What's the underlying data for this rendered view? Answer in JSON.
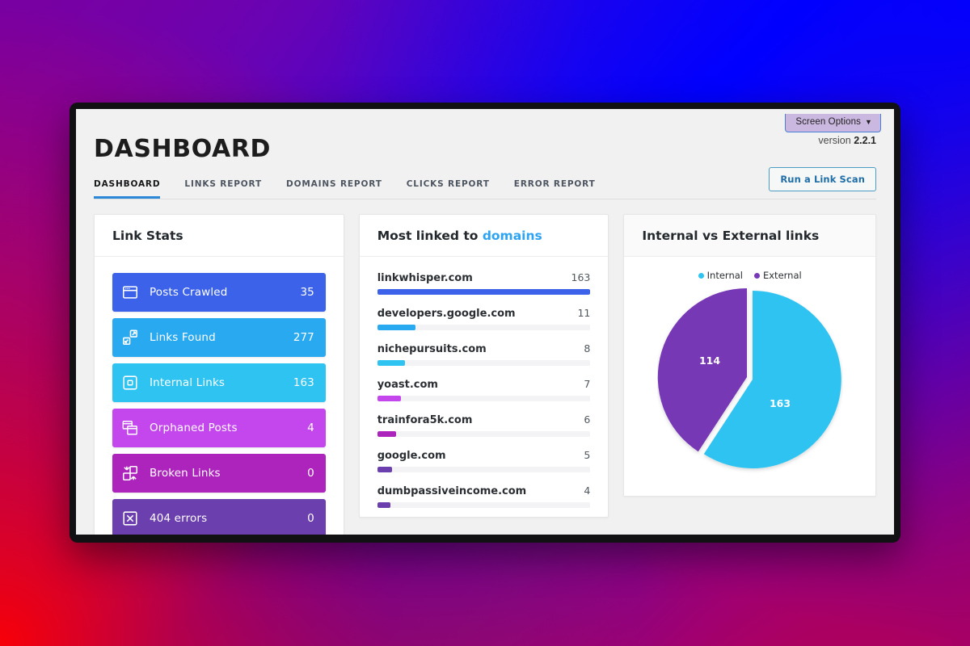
{
  "header": {
    "title": "DASHBOARD",
    "screen_options_label": "Screen Options",
    "screen_options_caret": "▼",
    "version_prefix": "version",
    "version_number": "2.2.1",
    "scan_button": "Run a Link Scan"
  },
  "tabs": [
    {
      "label": "DASHBOARD",
      "active": true
    },
    {
      "label": "LINKS REPORT",
      "active": false
    },
    {
      "label": "DOMAINS REPORT",
      "active": false
    },
    {
      "label": "CLICKS REPORT",
      "active": false
    },
    {
      "label": "ERROR REPORT",
      "active": false
    }
  ],
  "link_stats": {
    "title": "Link Stats",
    "rows": [
      {
        "label": "Posts Crawled",
        "value": "35",
        "color": "#3b62e8",
        "icon": "browser-window-icon"
      },
      {
        "label": "Links Found",
        "value": "277",
        "color": "#29a9f0",
        "icon": "linked-squares-icon"
      },
      {
        "label": "Internal Links",
        "value": "163",
        "color": "#2ec3f0",
        "icon": "square-in-square-icon"
      },
      {
        "label": "Orphaned Posts",
        "value": "4",
        "color": "#c447ee",
        "icon": "stacked-windows-icon"
      },
      {
        "label": "Broken Links",
        "value": "0",
        "color": "#ad24bd",
        "icon": "broken-link-icon"
      },
      {
        "label": "404 errors",
        "value": "0",
        "color": "#6b3fae",
        "icon": "x-box-icon"
      }
    ]
  },
  "most_linked": {
    "title_prefix": "Most linked to ",
    "title_accent": "domains",
    "items": [
      {
        "domain": "linkwhisper.com",
        "count": "163",
        "pct": 100,
        "color": "#3b62e8"
      },
      {
        "domain": "developers.google.com",
        "count": "11",
        "pct": 18,
        "color": "#29a9f0"
      },
      {
        "domain": "nichepursuits.com",
        "count": "8",
        "pct": 13,
        "color": "#2ec3f0"
      },
      {
        "domain": "yoast.com",
        "count": "7",
        "pct": 11,
        "color": "#c447ee"
      },
      {
        "domain": "trainfora5k.com",
        "count": "6",
        "pct": 9,
        "color": "#ad24bd"
      },
      {
        "domain": "google.com",
        "count": "5",
        "pct": 7,
        "color": "#6b3fae"
      },
      {
        "domain": "dumbpassiveincome.com",
        "count": "4",
        "pct": 6,
        "color": "#6b3fae"
      }
    ]
  },
  "chart_data": {
    "type": "pie",
    "title": "Internal vs External links",
    "legend_position": "top-center",
    "categories": [
      "Internal",
      "External"
    ],
    "values": [
      163,
      114
    ],
    "labels": [
      "163",
      "114"
    ],
    "colors": [
      "#2ec3f0",
      "#7739b5"
    ],
    "total": 277,
    "legend": [
      {
        "name": "Internal",
        "color": "#2ec3f0",
        "value": 163
      },
      {
        "name": "External",
        "color": "#7739b5",
        "value": 114
      }
    ]
  }
}
